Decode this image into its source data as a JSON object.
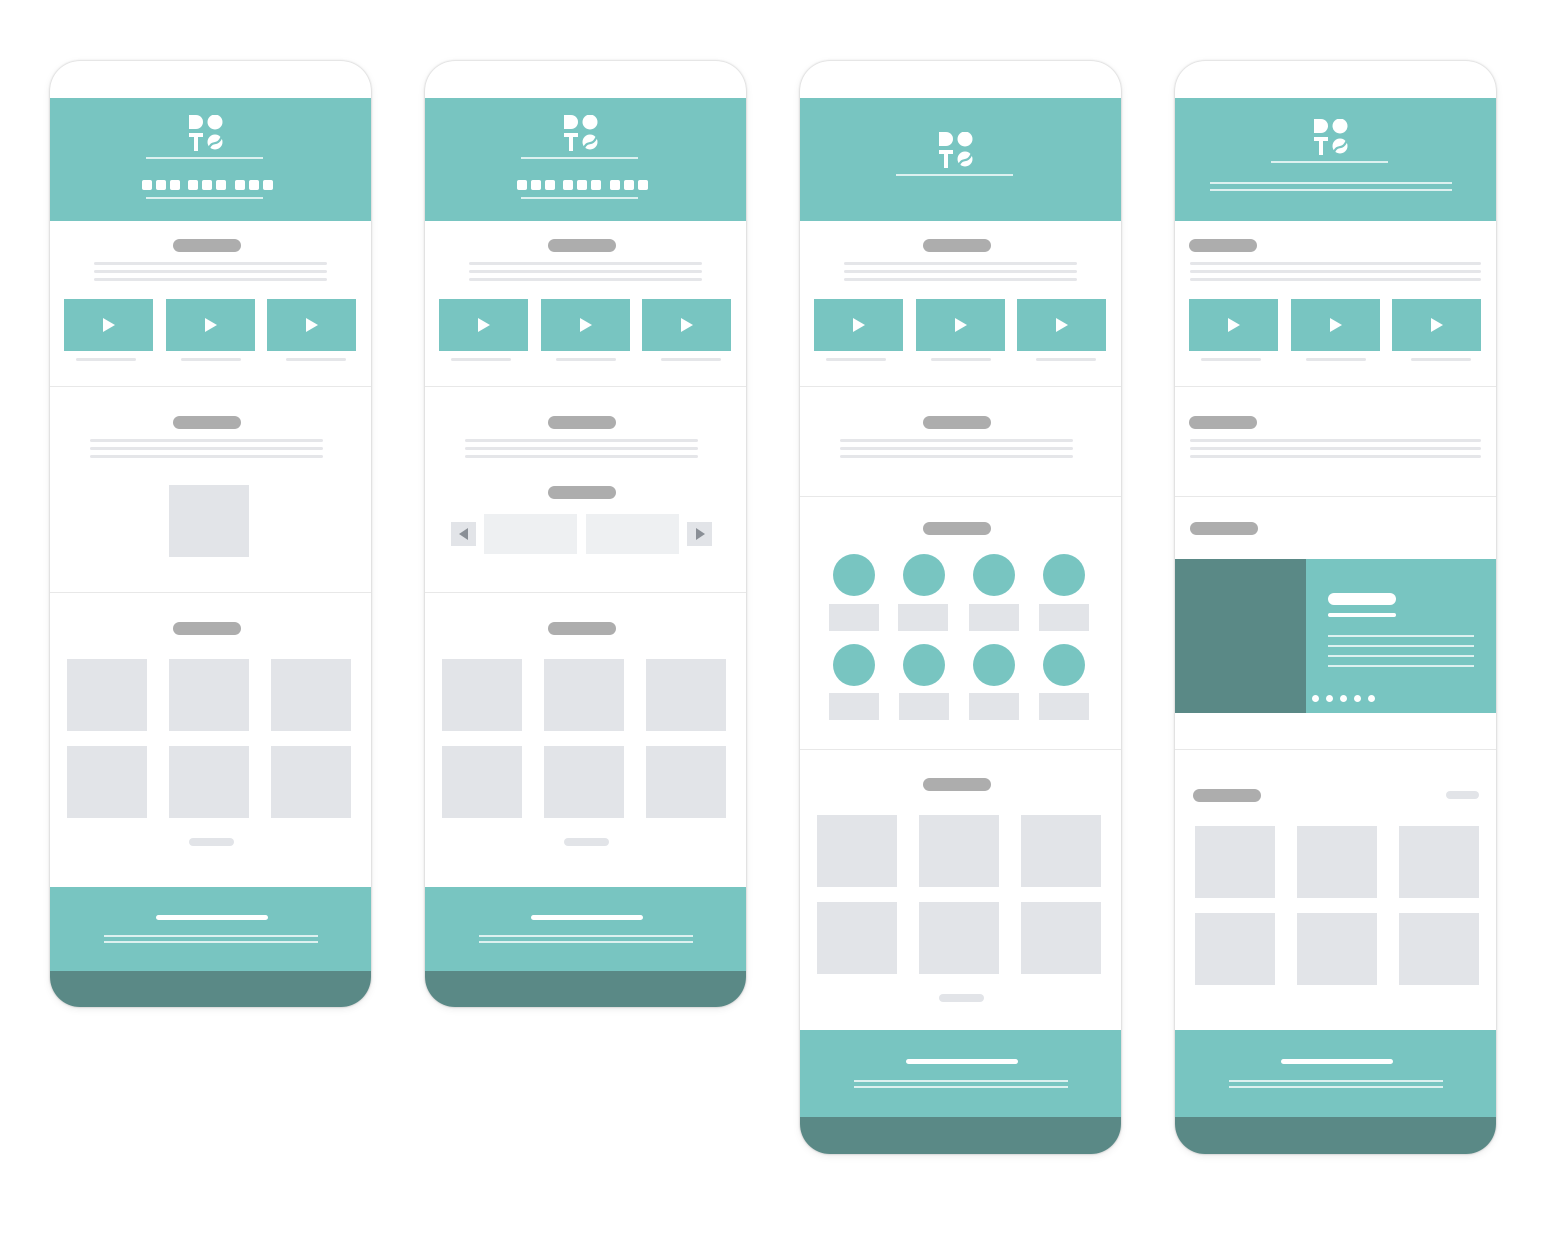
{
  "colors": {
    "accent": "#78c5c1",
    "accent_dark": "#5a8986",
    "placeholder": "#e2e4e8",
    "heading_placeholder": "#adadad",
    "background": "#ffffff"
  },
  "wireframes": [
    {
      "label": "",
      "logo_icon": "dots-logo-icon",
      "sections": [
        "header-nav",
        "video-row",
        "text-image",
        "image-grid",
        "footer"
      ]
    },
    {
      "label": "",
      "logo_icon": "dots-logo-icon",
      "sections": [
        "header-nav",
        "video-row",
        "carousel",
        "image-grid",
        "footer"
      ]
    },
    {
      "label": "",
      "logo_icon": "dots-logo-icon",
      "sections": [
        "header",
        "video-row",
        "text",
        "circle-grid",
        "image-grid",
        "footer"
      ]
    },
    {
      "label": "",
      "logo_icon": "dots-logo-icon",
      "sections": [
        "header-left",
        "video-row",
        "text",
        "hero-slider",
        "image-grid-see-all",
        "footer"
      ]
    }
  ],
  "icons": {
    "play": "play-icon",
    "prev": "arrow-left-icon",
    "next": "arrow-right-icon"
  }
}
